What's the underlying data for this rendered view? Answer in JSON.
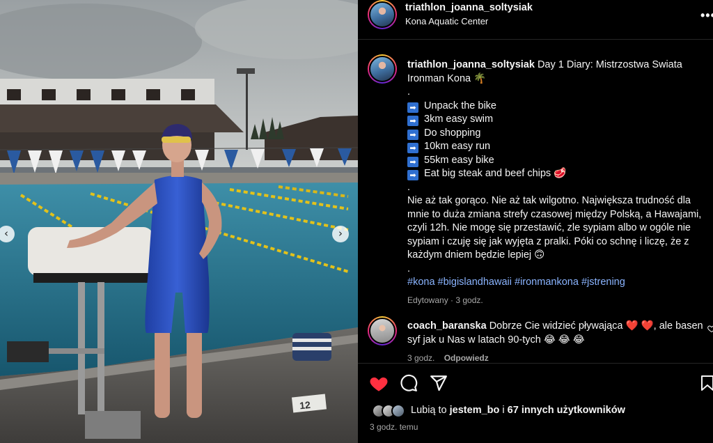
{
  "photo": {
    "alt_icons": [
      "chevron-left-icon",
      "chevron-right-icon"
    ],
    "lane_marker_text": "12",
    "prev_label": "‹",
    "next_label": "›"
  },
  "header": {
    "username": "triathlon_joanna_soltysiak",
    "location": "Kona Aquatic Center",
    "more_label": "•••"
  },
  "caption": {
    "username": "triathlon_joanna_soltysiak",
    "title": "Day 1 Diary: Mistrzostwa Swiata Ironman Kona 🌴",
    "dot1": ".",
    "todo": [
      "Unpack the bike",
      "3km easy swim",
      "Do shopping",
      "10km easy run",
      "55km easy bike",
      "Eat big steak and beef chips 🥩"
    ],
    "arrow_glyph": "➡",
    "dot2": ".",
    "paragraph": "Nie aż tak gorąco. Nie aż tak wilgotno. Największa trudność dla mnie to duża zmiana strefy czasowej między Polską, a Hawajami, czyli 12h. Nie mogę się przestawić, zle sypiam albo w ogóle nie sypiam i czuję się jak wyjęta z pralki. Póki co schnę i liczę, że z każdym dniem będzie lepiej 🙃",
    "dot3": ".",
    "hashtags": [
      "#kona",
      "#bigislandhawaii",
      "#ironmankona",
      "#jstrening"
    ],
    "edited": "Edytowany",
    "time": "3 godz."
  },
  "comment": {
    "username": "coach_baranska",
    "text": "Dobrze Cie widzieć pływająca ❤️ ❤️, ale basen syf jak u Nas w latach 90-tych 😂 😂 😂",
    "time": "3 godz.",
    "reply": "Odpowiedz"
  },
  "likes": {
    "prefix": "Lubią to",
    "user": "jestem_bo",
    "connector": "i",
    "others": "67 innych użytkowników"
  },
  "post_time": "3 godz. temu",
  "colors": {
    "background": "#000000",
    "text": "#f5f5f5",
    "muted": "#a8a8a8",
    "hashtag": "#8ab4ff",
    "like_red": "#ff3040",
    "arrow_box": "#2f6fd0"
  }
}
